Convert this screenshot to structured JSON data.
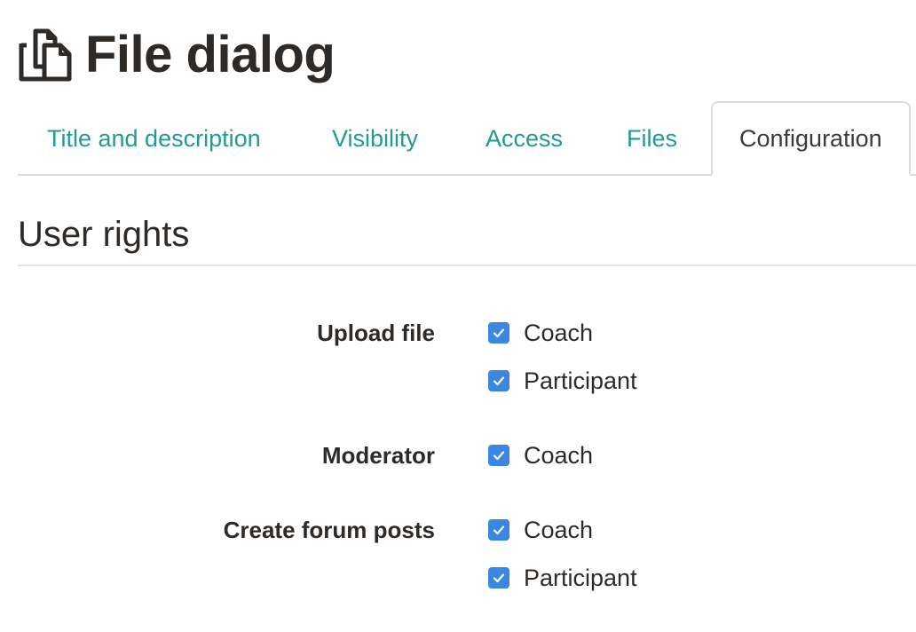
{
  "header": {
    "title": "File dialog",
    "icon": "files-copy-icon"
  },
  "tabs": [
    {
      "label": "Title and description",
      "active": false
    },
    {
      "label": "Visibility",
      "active": false
    },
    {
      "label": "Access",
      "active": false
    },
    {
      "label": "Files",
      "active": false
    },
    {
      "label": "Configuration",
      "active": true
    }
  ],
  "section": {
    "title": "User rights"
  },
  "rights": [
    {
      "label": "Upload file",
      "options": [
        {
          "label": "Coach",
          "checked": true
        },
        {
          "label": "Participant",
          "checked": true
        }
      ]
    },
    {
      "label": "Moderator",
      "options": [
        {
          "label": "Coach",
          "checked": true
        }
      ]
    },
    {
      "label": "Create forum posts",
      "options": [
        {
          "label": "Coach",
          "checked": true
        },
        {
          "label": "Participant",
          "checked": true
        }
      ]
    }
  ],
  "colors": {
    "tab_link": "#209c92",
    "checkbox_checked": "#3b86e3",
    "text": "#2e2a27"
  }
}
